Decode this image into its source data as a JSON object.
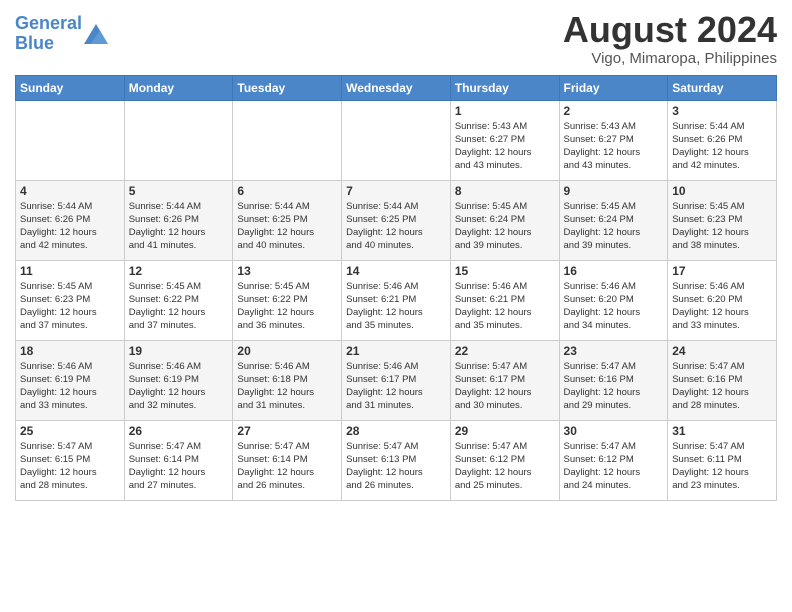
{
  "header": {
    "logo_line1": "General",
    "logo_line2": "Blue",
    "title": "August 2024",
    "location": "Vigo, Mimaropa, Philippines"
  },
  "weekdays": [
    "Sunday",
    "Monday",
    "Tuesday",
    "Wednesday",
    "Thursday",
    "Friday",
    "Saturday"
  ],
  "weeks": [
    [
      {
        "day": "",
        "info": ""
      },
      {
        "day": "",
        "info": ""
      },
      {
        "day": "",
        "info": ""
      },
      {
        "day": "",
        "info": ""
      },
      {
        "day": "1",
        "info": "Sunrise: 5:43 AM\nSunset: 6:27 PM\nDaylight: 12 hours\nand 43 minutes."
      },
      {
        "day": "2",
        "info": "Sunrise: 5:43 AM\nSunset: 6:27 PM\nDaylight: 12 hours\nand 43 minutes."
      },
      {
        "day": "3",
        "info": "Sunrise: 5:44 AM\nSunset: 6:26 PM\nDaylight: 12 hours\nand 42 minutes."
      }
    ],
    [
      {
        "day": "4",
        "info": "Sunrise: 5:44 AM\nSunset: 6:26 PM\nDaylight: 12 hours\nand 42 minutes."
      },
      {
        "day": "5",
        "info": "Sunrise: 5:44 AM\nSunset: 6:26 PM\nDaylight: 12 hours\nand 41 minutes."
      },
      {
        "day": "6",
        "info": "Sunrise: 5:44 AM\nSunset: 6:25 PM\nDaylight: 12 hours\nand 40 minutes."
      },
      {
        "day": "7",
        "info": "Sunrise: 5:44 AM\nSunset: 6:25 PM\nDaylight: 12 hours\nand 40 minutes."
      },
      {
        "day": "8",
        "info": "Sunrise: 5:45 AM\nSunset: 6:24 PM\nDaylight: 12 hours\nand 39 minutes."
      },
      {
        "day": "9",
        "info": "Sunrise: 5:45 AM\nSunset: 6:24 PM\nDaylight: 12 hours\nand 39 minutes."
      },
      {
        "day": "10",
        "info": "Sunrise: 5:45 AM\nSunset: 6:23 PM\nDaylight: 12 hours\nand 38 minutes."
      }
    ],
    [
      {
        "day": "11",
        "info": "Sunrise: 5:45 AM\nSunset: 6:23 PM\nDaylight: 12 hours\nand 37 minutes."
      },
      {
        "day": "12",
        "info": "Sunrise: 5:45 AM\nSunset: 6:22 PM\nDaylight: 12 hours\nand 37 minutes."
      },
      {
        "day": "13",
        "info": "Sunrise: 5:45 AM\nSunset: 6:22 PM\nDaylight: 12 hours\nand 36 minutes."
      },
      {
        "day": "14",
        "info": "Sunrise: 5:46 AM\nSunset: 6:21 PM\nDaylight: 12 hours\nand 35 minutes."
      },
      {
        "day": "15",
        "info": "Sunrise: 5:46 AM\nSunset: 6:21 PM\nDaylight: 12 hours\nand 35 minutes."
      },
      {
        "day": "16",
        "info": "Sunrise: 5:46 AM\nSunset: 6:20 PM\nDaylight: 12 hours\nand 34 minutes."
      },
      {
        "day": "17",
        "info": "Sunrise: 5:46 AM\nSunset: 6:20 PM\nDaylight: 12 hours\nand 33 minutes."
      }
    ],
    [
      {
        "day": "18",
        "info": "Sunrise: 5:46 AM\nSunset: 6:19 PM\nDaylight: 12 hours\nand 33 minutes."
      },
      {
        "day": "19",
        "info": "Sunrise: 5:46 AM\nSunset: 6:19 PM\nDaylight: 12 hours\nand 32 minutes."
      },
      {
        "day": "20",
        "info": "Sunrise: 5:46 AM\nSunset: 6:18 PM\nDaylight: 12 hours\nand 31 minutes."
      },
      {
        "day": "21",
        "info": "Sunrise: 5:46 AM\nSunset: 6:17 PM\nDaylight: 12 hours\nand 31 minutes."
      },
      {
        "day": "22",
        "info": "Sunrise: 5:47 AM\nSunset: 6:17 PM\nDaylight: 12 hours\nand 30 minutes."
      },
      {
        "day": "23",
        "info": "Sunrise: 5:47 AM\nSunset: 6:16 PM\nDaylight: 12 hours\nand 29 minutes."
      },
      {
        "day": "24",
        "info": "Sunrise: 5:47 AM\nSunset: 6:16 PM\nDaylight: 12 hours\nand 28 minutes."
      }
    ],
    [
      {
        "day": "25",
        "info": "Sunrise: 5:47 AM\nSunset: 6:15 PM\nDaylight: 12 hours\nand 28 minutes."
      },
      {
        "day": "26",
        "info": "Sunrise: 5:47 AM\nSunset: 6:14 PM\nDaylight: 12 hours\nand 27 minutes."
      },
      {
        "day": "27",
        "info": "Sunrise: 5:47 AM\nSunset: 6:14 PM\nDaylight: 12 hours\nand 26 minutes."
      },
      {
        "day": "28",
        "info": "Sunrise: 5:47 AM\nSunset: 6:13 PM\nDaylight: 12 hours\nand 26 minutes."
      },
      {
        "day": "29",
        "info": "Sunrise: 5:47 AM\nSunset: 6:12 PM\nDaylight: 12 hours\nand 25 minutes."
      },
      {
        "day": "30",
        "info": "Sunrise: 5:47 AM\nSunset: 6:12 PM\nDaylight: 12 hours\nand 24 minutes."
      },
      {
        "day": "31",
        "info": "Sunrise: 5:47 AM\nSunset: 6:11 PM\nDaylight: 12 hours\nand 23 minutes."
      }
    ]
  ]
}
